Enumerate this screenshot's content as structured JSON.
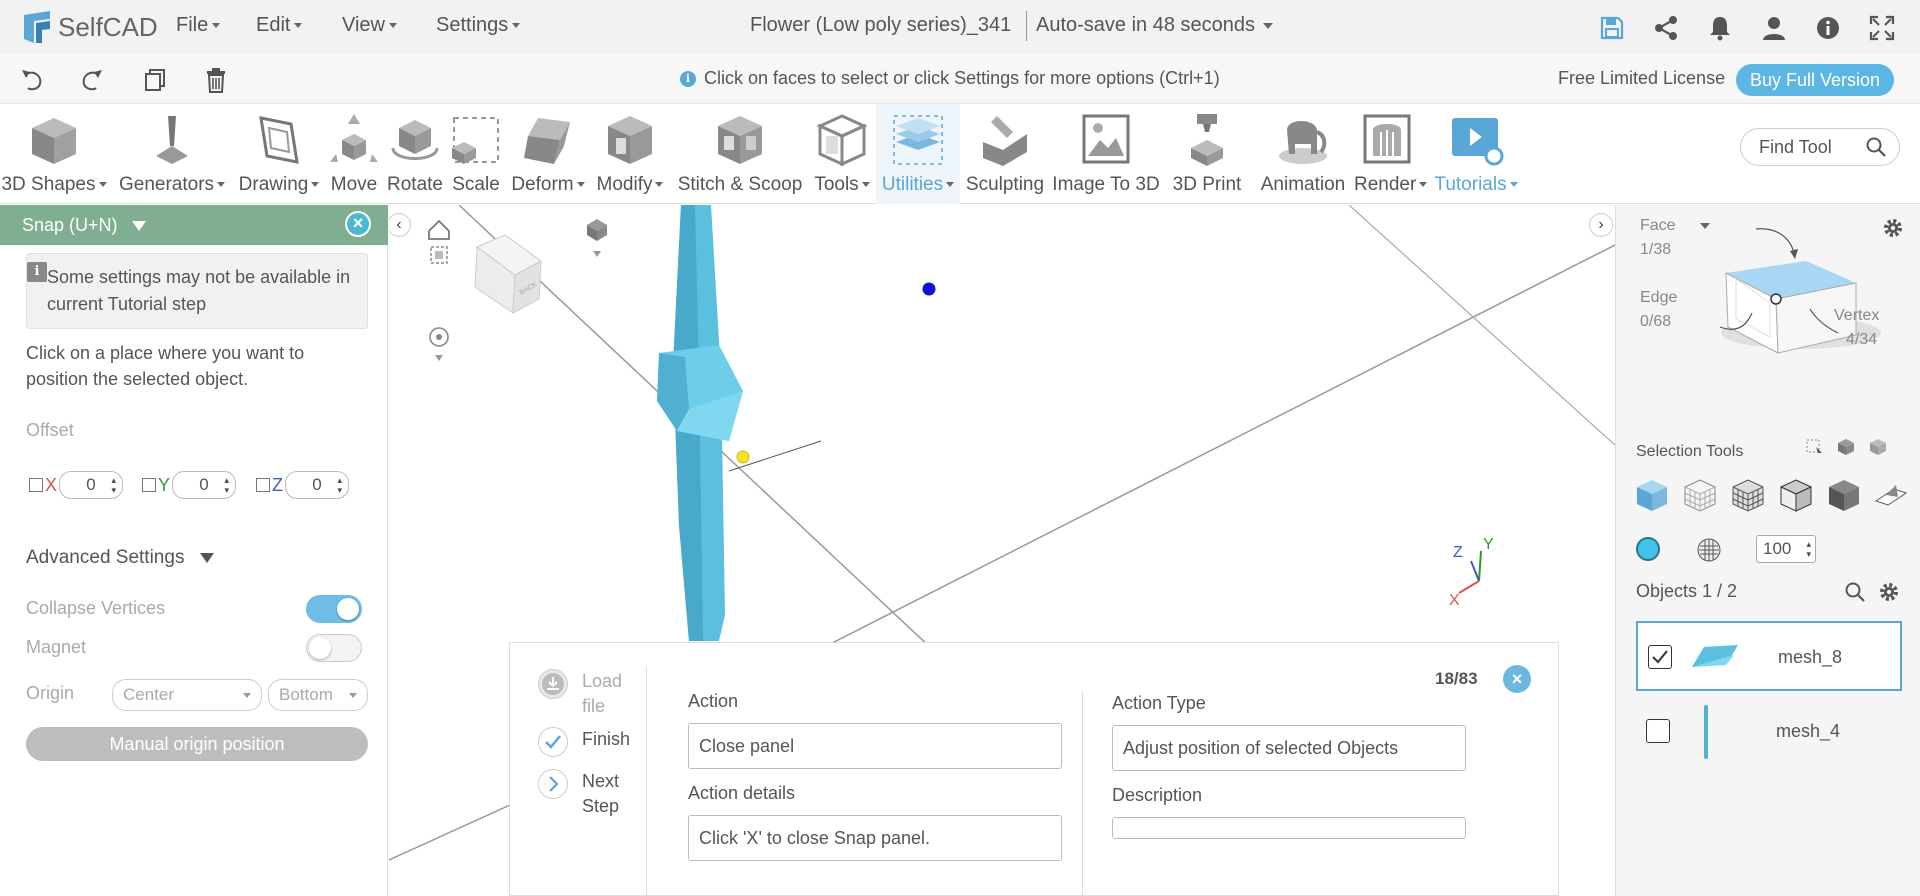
{
  "app": {
    "logo_text": "SelfCAD",
    "menus": [
      "File",
      "Edit",
      "View",
      "Settings"
    ],
    "document_title": "Flower (Low poly series)_341",
    "autosave": "Auto-save in 48 seconds"
  },
  "secondary_bar": {
    "hint": "Click on faces to select or click Settings for more options (Ctrl+1)",
    "license": "Free Limited License",
    "buy_button": "Buy Full Version"
  },
  "toolbar": {
    "tools": [
      {
        "label": "3D Shapes"
      },
      {
        "label": "Generators"
      },
      {
        "label": "Drawing"
      },
      {
        "label": "Move"
      },
      {
        "label": "Rotate"
      },
      {
        "label": "Scale"
      },
      {
        "label": "Deform"
      },
      {
        "label": "Modify"
      },
      {
        "label": "Stitch & Scoop"
      },
      {
        "label": "Tools"
      },
      {
        "label": "Utilities"
      },
      {
        "label": "Sculpting"
      },
      {
        "label": "Image To 3D"
      },
      {
        "label": "3D Print"
      },
      {
        "label": "Animation"
      },
      {
        "label": "Render"
      },
      {
        "label": "Tutorials"
      }
    ],
    "find_tool_placeholder": "Find Tool"
  },
  "snap_panel": {
    "title": "Snap (U+N)",
    "tutorial_note": "Some settings may not be available in current Tutorial step",
    "instruction": "Click on a place where you want to position the selected object.",
    "offset_label": "Offset",
    "x_label": "X",
    "y_label": "Y",
    "z_label": "Z",
    "x_value": "0",
    "y_value": "0",
    "z_value": "0",
    "advanced_label": "Advanced Settings",
    "collapse_vertices_label": "Collapse Vertices",
    "magnet_label": "Magnet",
    "origin_label": "Origin",
    "origin_select_1": "Center",
    "origin_select_2": "Bottom",
    "manual_origin_button": "Manual origin position"
  },
  "view_cube_label": "BACK",
  "axes": {
    "z": "Z",
    "y": "Y",
    "x": "X"
  },
  "tutorial": {
    "step_count": "18/83",
    "steps": [
      {
        "label": "Load file"
      },
      {
        "label": "Finish"
      },
      {
        "label": "Next Step"
      }
    ],
    "action_label": "Action",
    "action_value": "Close panel",
    "action_details_label": "Action details",
    "action_details_value": "Click 'X' to close Snap panel.",
    "action_type_label": "Action Type",
    "action_type_value": "Adjust position of selected Objects",
    "description_label": "Description",
    "description_value": ""
  },
  "right_panel": {
    "face_label": "Face",
    "face_count": "1/38",
    "edge_label": "Edge",
    "edge_count": "0/68",
    "vertex_label": "Vertex",
    "vertex_count": "4/34",
    "selection_tools_label": "Selection Tools",
    "opacity_value": "100",
    "objects_label": "Objects 1 / 2",
    "objects": [
      {
        "name": "mesh_8",
        "checked": true
      },
      {
        "name": "mesh_4",
        "checked": false
      }
    ]
  },
  "colors": {
    "accent": "#5aa6d6",
    "snap_header": "#7fae90",
    "object": "#5bc0de"
  }
}
